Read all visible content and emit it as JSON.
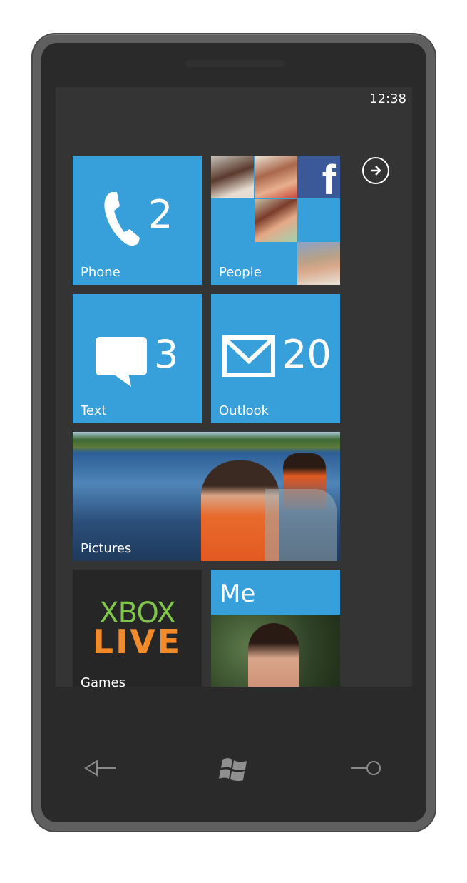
{
  "status_bar": {
    "time": "12:38"
  },
  "tiles": {
    "phone": {
      "label": "Phone",
      "count": "2",
      "icon": "phone-handset-icon"
    },
    "people": {
      "label": "People",
      "icon": "facebook-icon"
    },
    "text": {
      "label": "Text",
      "count": "3",
      "icon": "speech-bubble-icon"
    },
    "outlook": {
      "label": "Outlook",
      "count": "20",
      "icon": "envelope-icon"
    },
    "pictures": {
      "label": "Pictures"
    },
    "games": {
      "label": "Games",
      "logo_top": "XBOX",
      "logo_bottom": "LIVE"
    },
    "me": {
      "label": "Me"
    }
  },
  "app_list_button": {
    "icon": "arrow-right-circle-icon"
  },
  "hardware_buttons": {
    "back": {
      "icon": "back-arrow-icon"
    },
    "start": {
      "icon": "windows-logo-icon"
    },
    "search": {
      "icon": "search-icon"
    }
  },
  "colors": {
    "accent": "#37a0da",
    "screen_bg": "#343434",
    "facebook": "#3b5998",
    "xbox_green": "#7fc64a",
    "xbox_orange": "#f08a2a"
  }
}
